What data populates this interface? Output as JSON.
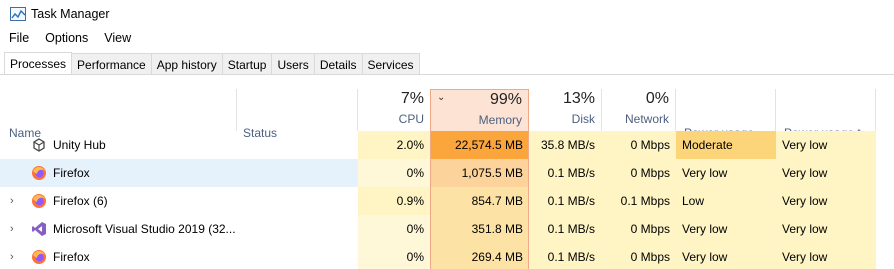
{
  "window": {
    "title": "Task Manager"
  },
  "menu": [
    "File",
    "Options",
    "View"
  ],
  "tabs": [
    "Processes",
    "Performance",
    "App history",
    "Startup",
    "Users",
    "Details",
    "Services"
  ],
  "columns": {
    "name": "Name",
    "status": "Status",
    "cpu": {
      "pct": "7%",
      "label": "CPU"
    },
    "memory": {
      "pct": "99%",
      "label": "Memory"
    },
    "disk": {
      "pct": "13%",
      "label": "Disk"
    },
    "network": {
      "pct": "0%",
      "label": "Network"
    },
    "power": "Power usage",
    "power_trend": "Power usage t..."
  },
  "rows": [
    {
      "name": "Unity Hub",
      "icon": "unity-icon",
      "expandable": false,
      "status": "",
      "cpu": "2.0%",
      "memory": "22,574.5 MB",
      "disk": "35.8 MB/s",
      "network": "0 Mbps",
      "power": "Moderate",
      "power_trend": "Very low",
      "selected": false
    },
    {
      "name": "Firefox",
      "icon": "firefox-icon",
      "expandable": false,
      "status": "",
      "cpu": "0%",
      "memory": "1,075.5 MB",
      "disk": "0.1 MB/s",
      "network": "0 Mbps",
      "power": "Very low",
      "power_trend": "Very low",
      "selected": true
    },
    {
      "name": "Firefox (6)",
      "icon": "firefox-icon",
      "expandable": true,
      "status": "",
      "cpu": "0.9%",
      "memory": "854.7 MB",
      "disk": "0.1 MB/s",
      "network": "0.1 Mbps",
      "power": "Low",
      "power_trend": "Very low",
      "selected": false
    },
    {
      "name": "Microsoft Visual Studio 2019 (32...",
      "icon": "visual-studio-icon",
      "expandable": true,
      "status": "",
      "cpu": "0%",
      "memory": "351.8 MB",
      "disk": "0.1 MB/s",
      "network": "0 Mbps",
      "power": "Very low",
      "power_trend": "Very low",
      "selected": false
    },
    {
      "name": "Firefox",
      "icon": "firefox-icon",
      "expandable": true,
      "status": "",
      "cpu": "0%",
      "memory": "269.4 MB",
      "disk": "0.1 MB/s",
      "network": "0 Mbps",
      "power": "Very low",
      "power_trend": "Very low",
      "selected": false
    }
  ],
  "heat_colors": {
    "light": "#fff4c4",
    "lighter": "#fef7d8",
    "mem_hot": "#fba53d",
    "mem_warm": "#fcd49b",
    "mem_mid": "#fde2a6",
    "power_moderate": "#fcd57a",
    "selected": "#e5f1fb",
    "mem_header": "#fde3d4"
  }
}
